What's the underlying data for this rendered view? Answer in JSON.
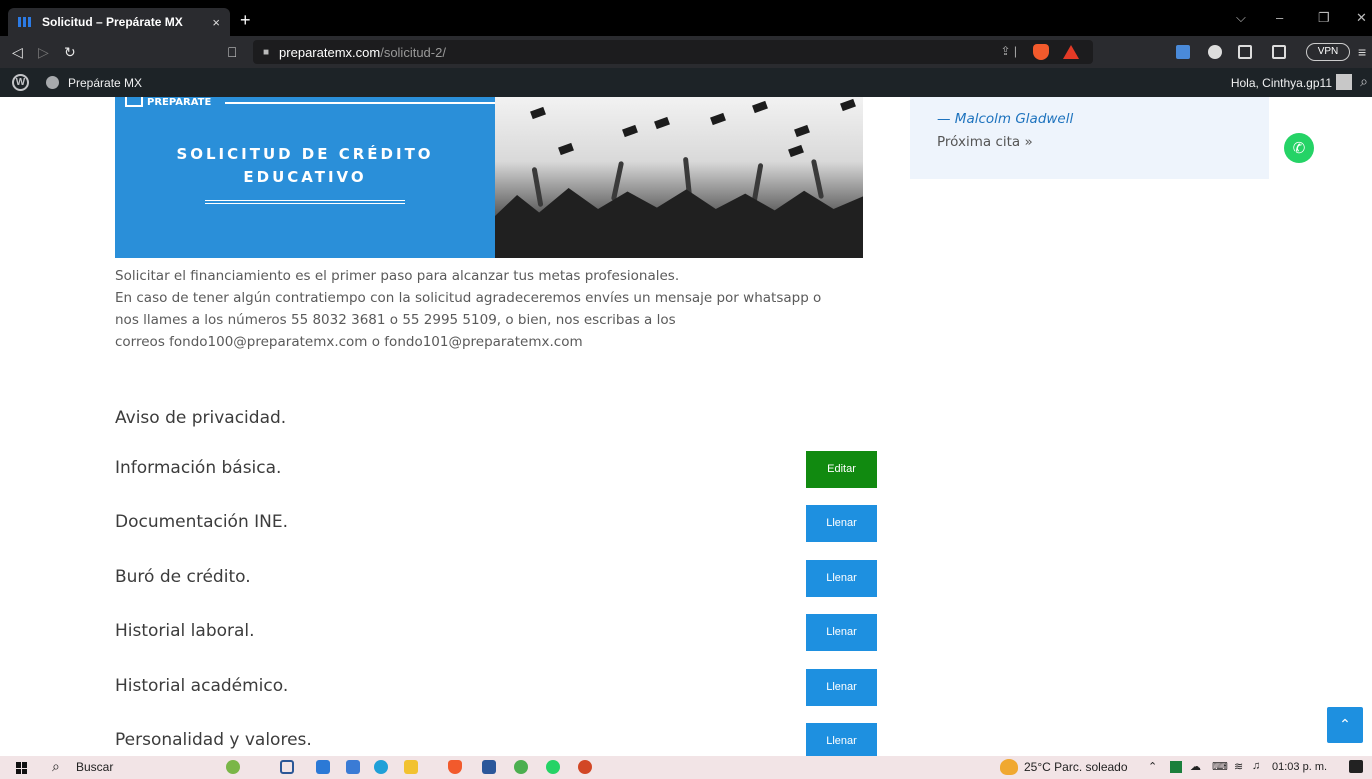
{
  "browser": {
    "tab_title": "Solicitud – Prepárate MX",
    "tab_close": "×",
    "new_tab": "+",
    "url_host": "preparatemx.com",
    "url_path": "/solicitud-2/",
    "vpn_label": "VPN",
    "controls": {
      "minimize": "–",
      "restore": "❐",
      "close": "✕",
      "chevron": "⌵"
    }
  },
  "wp_admin": {
    "site_name": "Prepárate MX",
    "greeting": "Hola, Cinthya.gp11"
  },
  "banner": {
    "logo_text": "PREPÁRATE",
    "title_line1": "SOLICITUD DE CRÉDITO",
    "title_line2": "EDUCATIVO"
  },
  "intro": {
    "line1": "Solicitar el financiamiento es el primer paso para alcanzar tus metas profesionales.",
    "line2": "En caso de tener algún contratiempo con la solicitud agradeceremos envíes un mensaje por whatsapp o",
    "line3": "nos llames a los números 55 8032 3681 o 55 2995 5109, o bien, nos escribas a los",
    "line4": "correos fondo100@preparatemx.com o fondo101@preparatemx.com"
  },
  "sections": {
    "privacy": "Aviso de privacidad.",
    "basic": {
      "label": "Información básica.",
      "button": "Editar"
    },
    "ine": {
      "label": "Documentación INE.",
      "button": "Llenar"
    },
    "buro": {
      "label": "Buró de crédito.",
      "button": "Llenar"
    },
    "work": {
      "label": "Historial laboral.",
      "button": "Llenar"
    },
    "academic": {
      "label": "Historial académico.",
      "button": "Llenar"
    },
    "personality": {
      "label": "Personalidad y valores.",
      "button": "Llenar"
    }
  },
  "quote": {
    "author": "— Malcolm Gladwell",
    "next": "Próxima cita »"
  },
  "taskbar": {
    "search": "Buscar",
    "weather": "25°C  Parc. soleado",
    "clock": "01:03 p. m."
  },
  "colors": {
    "primary_blue": "#1e90e0",
    "edit_green": "#118a10",
    "whatsapp_green": "#25d366"
  },
  "icons": [
    "wordpress-icon",
    "search-icon",
    "whatsapp-icon",
    "chevron-up-icon",
    "lock-icon",
    "bookmark-icon",
    "back-icon",
    "forward-icon",
    "reload-icon"
  ]
}
